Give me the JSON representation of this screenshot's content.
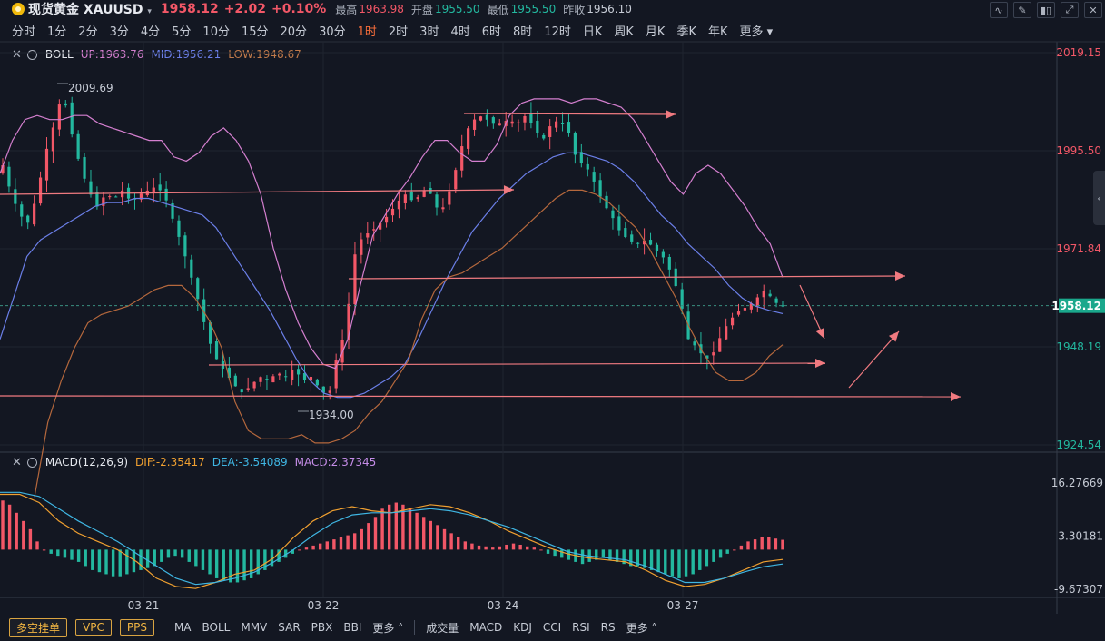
{
  "header": {
    "name": "现货黄金",
    "symbol": "XAUUSD",
    "price": "1958.12",
    "change": "+2.02",
    "change_pct": "+0.10%",
    "high_label": "最高",
    "high": "1963.98",
    "open_label": "开盘",
    "open": "1955.50",
    "low_label": "最低",
    "low": "1955.50",
    "prev_label": "昨收",
    "prev": "1956.10"
  },
  "timeframes": [
    "分时",
    "1分",
    "2分",
    "3分",
    "4分",
    "5分",
    "10分",
    "15分",
    "20分",
    "30分",
    "1时",
    "2时",
    "3时",
    "4时",
    "6时",
    "8时",
    "12时",
    "日K",
    "周K",
    "月K",
    "季K",
    "年K",
    "更多"
  ],
  "active_timeframe": "1时",
  "boll_legend": {
    "name": "BOLL",
    "up": "UP:1963.76",
    "mid": "MID:1956.21",
    "low": "LOW:1948.67"
  },
  "macd_legend": {
    "name": "MACD(12,26,9)",
    "dif": "DIF:-2.35417",
    "dea": "DEA:-3.54089",
    "macd": "MACD:2.37345"
  },
  "bottom_bar": {
    "overlay_buttons": [
      "多空挂单",
      "VPC",
      "PPS"
    ],
    "main_indicators": [
      "MA",
      "BOLL",
      "MMV",
      "SAR",
      "PBX",
      "BBI",
      "更多"
    ],
    "sub_indicators": [
      "成交量",
      "MACD",
      "KDJ",
      "CCI",
      "RSI",
      "RS",
      "更多"
    ]
  },
  "colors": {
    "up": "#f25767",
    "down": "#23b89f",
    "boll_up": "#d47fcf",
    "boll_mid": "#6b7fe8",
    "boll_low": "#b5683d",
    "dif": "#f0a030",
    "dea": "#3fb6e3",
    "annotation": "#f07a80",
    "active": "#f26b3a"
  },
  "chart_data": [
    {
      "type": "candlestick",
      "title": "BOLL",
      "ylim": [
        1924.54,
        2019.15
      ],
      "price_axis_ticks": [
        "2019.15",
        "1995.50",
        "1971.84",
        "1948.19",
        "1924.54"
      ],
      "current_price": "1958.12",
      "x_tick_labels": [
        "03-21",
        "03-22",
        "03-24",
        "03-27"
      ],
      "annotations": [
        "2009.69",
        "1934.00"
      ],
      "close_path": [
        1992,
        1985,
        1980,
        1978,
        1985,
        1995,
        2002,
        2009.7,
        2000,
        1992,
        1986,
        1982,
        1985,
        1984,
        1986,
        1983,
        1985,
        1986,
        1987,
        1984,
        1978,
        1972,
        1965,
        1958,
        1950,
        1945,
        1942,
        1939,
        1937,
        1939,
        1941,
        1940,
        1942,
        1941,
        1943,
        1940,
        1941,
        1938,
        1936,
        1946,
        1952,
        1970,
        1975,
        1976,
        1978,
        1980,
        1983,
        1985,
        1983,
        1986,
        1985,
        1980,
        1985,
        1992,
        2000,
        2003,
        2004,
        2002,
        2002,
        2003,
        2002,
        2004,
        2001,
        1998,
        2002,
        2003,
        2000,
        1993,
        1992,
        1988,
        1983,
        1980,
        1976,
        1974,
        1973,
        1974,
        1972,
        1970,
        1966,
        1960,
        1950,
        1948,
        1945,
        1947,
        1952,
        1955,
        1957,
        1958,
        1960,
        1962,
        1959,
        1958.12
      ],
      "boll_up_path": [
        1990,
        1998,
        2003,
        2004,
        2003,
        2003,
        2004,
        2004,
        2002,
        2001,
        2000,
        1999,
        1998,
        1998,
        1994,
        1993,
        1995,
        1999,
        2001,
        1998,
        1993,
        1985,
        1972,
        1962,
        1954,
        1948,
        1944,
        1943,
        1950,
        1963,
        1975,
        1980,
        1985,
        1989,
        1994,
        1998,
        1998,
        1995,
        1993,
        1993,
        1997,
        2004,
        2007,
        2008,
        2008,
        2008,
        2007,
        2008,
        2008,
        2007,
        2006,
        2003,
        1998,
        1993,
        1988,
        1985,
        1990,
        1992,
        1990,
        1986,
        1982,
        1977,
        1973,
        1965
      ],
      "boll_mid_path": [
        1950,
        1960,
        1970,
        1974,
        1976,
        1978,
        1980,
        1982,
        1983,
        1983,
        1984,
        1984,
        1983,
        1982,
        1981,
        1980,
        1977,
        1972,
        1967,
        1962,
        1957,
        1951,
        1945,
        1940,
        1937,
        1936,
        1936,
        1937,
        1939,
        1941,
        1944,
        1950,
        1957,
        1964,
        1970,
        1976,
        1980,
        1984,
        1987,
        1990,
        1992,
        1994,
        1995,
        1995,
        1994,
        1993,
        1991,
        1988,
        1984,
        1980,
        1977,
        1973,
        1970,
        1967,
        1963,
        1960,
        1958,
        1957,
        1956.2
      ],
      "boll_low_path": [
        1912,
        1930,
        1940,
        1948,
        1954,
        1956,
        1957,
        1958,
        1960,
        1962,
        1963,
        1963,
        1960,
        1955,
        1948,
        1935,
        1928,
        1926,
        1926,
        1926,
        1927,
        1925,
        1925,
        1926,
        1928,
        1932,
        1935,
        1940,
        1945,
        1955,
        1962,
        1965,
        1966,
        1968,
        1970,
        1972,
        1975,
        1978,
        1981,
        1984,
        1986,
        1986,
        1985,
        1983,
        1980,
        1977,
        1972,
        1966,
        1960,
        1953,
        1947,
        1942,
        1940,
        1940,
        1942,
        1946,
        1948.7
      ]
    },
    {
      "type": "bar+line",
      "title": "MACD(12,26,9)",
      "ylim": [
        -9.67307,
        16.27669
      ],
      "axis_ticks": [
        "16.27669",
        "3.30181",
        "-9.67307"
      ],
      "histogram": [
        12,
        11,
        9,
        7,
        5,
        2,
        0,
        -1,
        -1.5,
        -2,
        -2.5,
        -3,
        -4,
        -5,
        -5.5,
        -6,
        -6.5,
        -6.5,
        -6,
        -5.5,
        -5,
        -4.5,
        -4,
        -3,
        -2,
        -1.5,
        -2,
        -3,
        -4,
        -5,
        -6,
        -7,
        -7.5,
        -8,
        -8,
        -7.5,
        -7,
        -6,
        -5,
        -4,
        -3,
        -2,
        -1,
        0,
        0.5,
        1,
        1.5,
        2,
        2.5,
        3,
        3.5,
        4,
        5,
        6.5,
        8,
        10,
        11,
        11.5,
        11,
        10,
        9,
        8,
        7,
        6,
        5,
        4,
        3,
        2,
        1.5,
        1,
        0.8,
        0.5,
        0.8,
        1.2,
        1.5,
        1.2,
        0.8,
        0.5,
        0,
        -1,
        -1.5,
        -2,
        -2.5,
        -3,
        -3.5,
        -3,
        -2.5,
        -2,
        -2.5,
        -3,
        -3.5,
        -4,
        -4,
        -4.5,
        -5,
        -5.5,
        -6,
        -6.5,
        -7,
        -6.5,
        -6,
        -5,
        -4,
        -3,
        -2,
        -1,
        0,
        1,
        2,
        2.5,
        3,
        3,
        2.7,
        2.4
      ],
      "dif_path": [
        13.5,
        13.5,
        11.5,
        7,
        4,
        2,
        0,
        -3,
        -7,
        -9,
        -9.5,
        -8,
        -6,
        -5,
        -2,
        3,
        7,
        9.5,
        10.5,
        9.5,
        9,
        10,
        11,
        10.5,
        9,
        7,
        4.5,
        2.5,
        0.5,
        -1,
        -2,
        -2.5,
        -3,
        -5,
        -7.5,
        -9,
        -8.5,
        -7,
        -5,
        -3,
        -2.4
      ],
      "dea_path": [
        14,
        14,
        13,
        10,
        7,
        4.5,
        2,
        -1,
        -4,
        -7,
        -8.5,
        -8,
        -7,
        -5.5,
        -3,
        0,
        3.5,
        6.5,
        8.5,
        9,
        9,
        9.5,
        10,
        9.5,
        8.5,
        7,
        5.5,
        3.5,
        1.5,
        -0.5,
        -1.5,
        -2,
        -2.5,
        -4,
        -6,
        -8,
        -8,
        -7,
        -5.5,
        -4.2,
        -3.5
      ]
    }
  ]
}
